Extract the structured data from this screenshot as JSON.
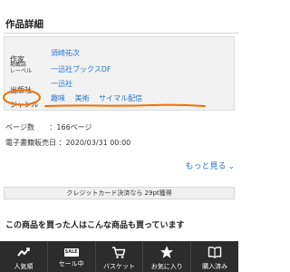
{
  "section": {
    "title": "作品詳細"
  },
  "details": {
    "author": {
      "label": "作家",
      "value": "須崎祐次"
    },
    "label": {
      "label_line1": "掲載誌",
      "label_line2": "レーベル",
      "value": "一迅社ブックスDF"
    },
    "publisher": {
      "label": "出版社",
      "value": "一迅社"
    },
    "genre": {
      "label": "ジャンル",
      "values": [
        "趣味",
        "美術",
        "サイマル配信"
      ]
    }
  },
  "pages": {
    "label": "ページ数",
    "value": "：166ページ"
  },
  "release": {
    "label": "電子書籍販売日",
    "value": "：2020/03/31 00:00"
  },
  "more": {
    "label": "もっと見る"
  },
  "credit": {
    "text": "クレジットカード決済なら 29pt獲得"
  },
  "recommend": {
    "title": "この商品を買った人はこんな商品も買っています"
  },
  "nav": {
    "items": [
      {
        "label": "人気順",
        "icon": "trend-icon"
      },
      {
        "label": "セール中",
        "icon": "sale-icon",
        "badge": "SALE"
      },
      {
        "label": "バスケット",
        "icon": "cart-icon"
      },
      {
        "label": "お気に入り",
        "icon": "star-icon"
      },
      {
        "label": "購入済み",
        "icon": "book-icon"
      }
    ]
  },
  "colors": {
    "link": "#2a75c9",
    "annotation": "#f07000",
    "nav_bg": "#2c2c2c"
  }
}
